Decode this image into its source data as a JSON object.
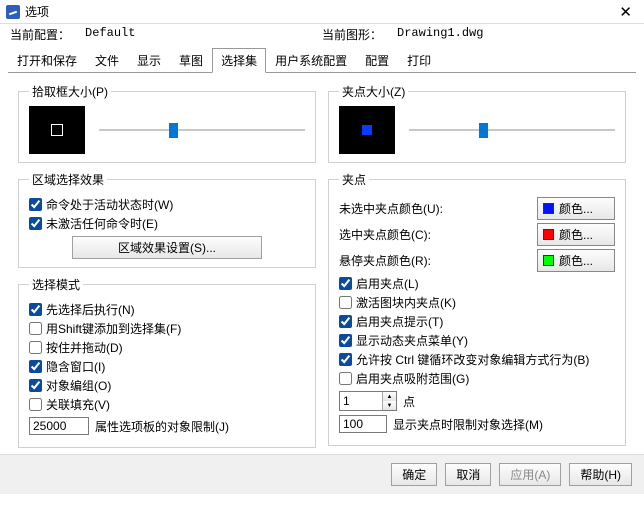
{
  "window": {
    "title": "选项"
  },
  "header": {
    "cfg_label": "当前配置：",
    "cfg_value": "Default",
    "drawing_label": "当前图形：",
    "drawing_value": "Drawing1.dwg"
  },
  "tabs": [
    "打开和保存",
    "文件",
    "显示",
    "草图",
    "选择集",
    "用户系统配置",
    "配置",
    "打印"
  ],
  "active_tab": "选择集",
  "left": {
    "pickbox_legend": "拾取框大小(P)",
    "region_legend": "区域选择效果",
    "region_chk1": "命令处于活动状态时(W)",
    "region_chk2": "未激活任何命令时(E)",
    "region_btn": "区域效果设置(S)...",
    "selmode_legend": "选择模式",
    "sm1": "先选择后执行(N)",
    "sm2": "用Shift键添加到选择集(F)",
    "sm3": "按住并拖动(D)",
    "sm4": "隐含窗口(I)",
    "sm5": "对象编组(O)",
    "sm6": "关联填充(V)",
    "limit_value": "25000",
    "limit_label": "属性选项板的对象限制(J)"
  },
  "right": {
    "gripsize_legend": "夹点大小(Z)",
    "grips_legend": "夹点",
    "c1_label": "未选中夹点颜色(U):",
    "c2_label": "选中夹点颜色(C):",
    "c3_label": "悬停夹点颜色(R):",
    "color_btn": "颜色...",
    "c1": "#0012ff",
    "c2": "#ff0000",
    "c3": "#00ff00",
    "g1": "启用夹点(L)",
    "g2": "激活图块内夹点(K)",
    "g3": "启用夹点提示(T)",
    "g4": "显示动态夹点菜单(Y)",
    "g5": "允许按 Ctrl 键循环改变对象编辑方式行为(B)",
    "g6": "启用夹点吸附范围(G)",
    "spin1": "1",
    "spin1_lbl": "点",
    "spin2": "100",
    "spin2_lbl": "显示夹点时限制对象选择(M)"
  },
  "footer": {
    "ok": "确定",
    "cancel": "取消",
    "apply": "应用(A)",
    "help": "帮助(H)"
  }
}
